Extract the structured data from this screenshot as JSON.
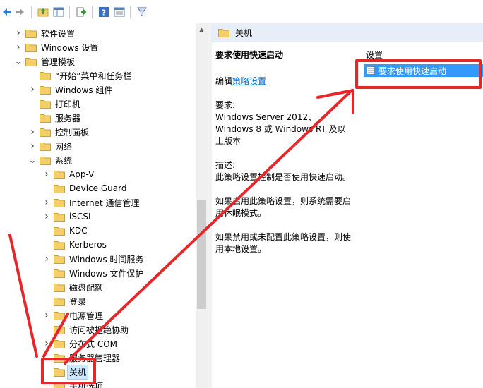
{
  "tree": {
    "items": [
      {
        "label": "软件设置",
        "level": 1,
        "expand": "collapsed"
      },
      {
        "label": "Windows 设置",
        "level": 1,
        "expand": "collapsed"
      },
      {
        "label": "管理模板",
        "level": 1,
        "expand": "expanded"
      },
      {
        "label": "“开始”菜单和任务栏",
        "level": 2,
        "expand": "none"
      },
      {
        "label": "Windows 组件",
        "level": 2,
        "expand": "collapsed"
      },
      {
        "label": "打印机",
        "level": 2,
        "expand": "none"
      },
      {
        "label": "服务器",
        "level": 2,
        "expand": "none"
      },
      {
        "label": "控制面板",
        "level": 2,
        "expand": "collapsed"
      },
      {
        "label": "网络",
        "level": 2,
        "expand": "collapsed"
      },
      {
        "label": "系统",
        "level": 2,
        "expand": "expanded"
      },
      {
        "label": "App-V",
        "level": 3,
        "expand": "collapsed"
      },
      {
        "label": "Device Guard",
        "level": 3,
        "expand": "none"
      },
      {
        "label": "Internet 通信管理",
        "level": 3,
        "expand": "collapsed"
      },
      {
        "label": "iSCSI",
        "level": 3,
        "expand": "collapsed"
      },
      {
        "label": "KDC",
        "level": 3,
        "expand": "none"
      },
      {
        "label": "Kerberos",
        "level": 3,
        "expand": "none"
      },
      {
        "label": "Windows 时间服务",
        "level": 3,
        "expand": "collapsed"
      },
      {
        "label": "Windows 文件保护",
        "level": 3,
        "expand": "none"
      },
      {
        "label": "磁盘配额",
        "level": 3,
        "expand": "none"
      },
      {
        "label": "登录",
        "level": 3,
        "expand": "none"
      },
      {
        "label": "电源管理",
        "level": 3,
        "expand": "collapsed"
      },
      {
        "label": "访问被拒绝协助",
        "level": 3,
        "expand": "none"
      },
      {
        "label": "分布式 COM",
        "level": 3,
        "expand": "collapsed"
      },
      {
        "label": "服务器管理器",
        "level": 3,
        "expand": "none"
      },
      {
        "label": "关机",
        "level": 3,
        "expand": "none",
        "selected": true
      },
      {
        "label": "关机选项",
        "level": 3,
        "expand": "none"
      }
    ]
  },
  "pane": {
    "header_title": "关机",
    "policy_title": "要求使用快速启动",
    "edit_prefix": "编辑",
    "edit_link": "策略设置",
    "requirements_label": "要求:",
    "requirements_text": "Windows Server 2012、Windows 8 或 Windows RT 及以上版本",
    "description_label": "描述:",
    "description_text": "此策略设置控制是否使用快速启动。",
    "enabled_text": "如果启用此策略设置，则系统需要启用休眠模式。",
    "disabled_text": "如果禁用或未配置此策略设置，则使用本地设置。"
  },
  "list": {
    "column_header": "设置",
    "rows": [
      {
        "label": "要求使用快速启动"
      }
    ]
  },
  "colors": {
    "folder": "#f3cf6a",
    "selection": "#3399ff",
    "annotation": "#e8262a"
  }
}
